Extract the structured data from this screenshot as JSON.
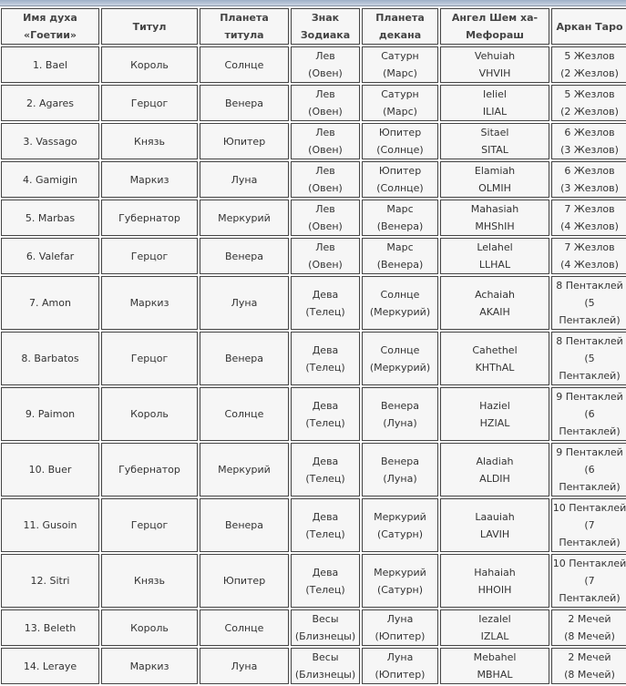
{
  "headers": [
    "Имя духа «Гоетии»",
    "Титул",
    "Планета титула",
    "Знак Зодиака",
    "Планета декана",
    "Ангел Шем ха-Мефораш",
    "Аркан Таро"
  ],
  "rows": [
    [
      "1. Bael",
      "Король",
      "Солнце",
      [
        "Лев",
        "(Овен)"
      ],
      [
        "Сатурн",
        "(Марс)"
      ],
      [
        "Vehuiah",
        "VHVIH"
      ],
      [
        "5 Жезлов",
        "(2 Жезлов)"
      ]
    ],
    [
      "2. Agares",
      "Герцог",
      "Венера",
      [
        "Лев",
        "(Овен)"
      ],
      [
        "Сатурн",
        "(Марс)"
      ],
      [
        "Ieliel",
        "ILIAL"
      ],
      [
        "5 Жезлов",
        "(2 Жезлов)"
      ]
    ],
    [
      "3. Vassago",
      "Князь",
      "Юпитер",
      [
        "Лев",
        "(Овен)"
      ],
      [
        "Юпитер",
        "(Солнце)"
      ],
      [
        "Sitael",
        "SITAL"
      ],
      [
        "6 Жезлов",
        "(3 Жезлов)"
      ]
    ],
    [
      "4. Gamigin",
      "Маркиз",
      "Луна",
      [
        "Лев",
        "(Овен)"
      ],
      [
        "Юпитер",
        "(Солнце)"
      ],
      [
        "Elamiah",
        "OLMIH"
      ],
      [
        "6 Жезлов",
        "(3 Жезлов)"
      ]
    ],
    [
      "5. Marbas",
      "Губернатор",
      "Меркурий",
      [
        "Лев",
        "(Овен)"
      ],
      [
        "Марс",
        "(Венера)"
      ],
      [
        "Mahasiah",
        "MHShIH"
      ],
      [
        "7 Жезлов",
        "(4 Жезлов)"
      ]
    ],
    [
      "6. Valefar",
      "Герцог",
      "Венера",
      [
        "Лев",
        "(Овен)"
      ],
      [
        "Марс",
        "(Венера)"
      ],
      [
        "Lelahel",
        "LLHAL"
      ],
      [
        "7 Жезлов",
        "(4 Жезлов)"
      ]
    ],
    [
      "7. Amon",
      "Маркиз",
      "Луна",
      [
        "Дева",
        "(Телец)"
      ],
      [
        "Солнце",
        "(Меркурий)"
      ],
      [
        "Achaiah",
        "AKAIH"
      ],
      [
        "8 Пентаклей",
        "(5 Пентаклей)"
      ]
    ],
    [
      "8. Barbatos",
      "Герцог",
      "Венера",
      [
        "Дева",
        "(Телец)"
      ],
      [
        "Солнце",
        "(Меркурий)"
      ],
      [
        "Cahethel",
        "KHThAL"
      ],
      [
        "8 Пентаклей",
        "(5 Пентаклей)"
      ]
    ],
    [
      "9. Paimon",
      "Король",
      "Солнце",
      [
        "Дева",
        "(Телец)"
      ],
      [
        "Венера",
        "(Луна)"
      ],
      [
        "Haziel",
        "HZIAL"
      ],
      [
        "9 Пентаклей",
        "(6 Пентаклей)"
      ]
    ],
    [
      "10. Buer",
      "Губернатор",
      "Меркурий",
      [
        "Дева",
        "(Телец)"
      ],
      [
        "Венера",
        "(Луна)"
      ],
      [
        "Aladiah",
        "ALDIH"
      ],
      [
        "9 Пентаклей",
        "(6 Пентаклей)"
      ]
    ],
    [
      "11. Gusoin",
      "Герцог",
      "Венера",
      [
        "Дева",
        "(Телец)"
      ],
      [
        "Меркурий",
        "(Сатурн)"
      ],
      [
        "Laauiah",
        "LAVIH"
      ],
      [
        "10 Пентаклей",
        "(7 Пентаклей)"
      ]
    ],
    [
      "12. Sitri",
      "Князь",
      "Юпитер",
      [
        "Дева",
        "(Телец)"
      ],
      [
        "Меркурий",
        "(Сатурн)"
      ],
      [
        "Hahaiah",
        "HHOIH"
      ],
      [
        "10 Пентаклей",
        "(7 Пентаклей)"
      ]
    ],
    [
      "13. Beleth",
      "Король",
      "Солнце",
      [
        "Весы",
        "(Близнецы)"
      ],
      [
        "Луна",
        "(Юпитер)"
      ],
      [
        "Iezalel",
        "IZLAL"
      ],
      [
        "2 Мечей",
        "(8 Мечей)"
      ]
    ],
    [
      "14. Leraye",
      "Маркиз",
      "Луна",
      [
        "Весы",
        "(Близнецы)"
      ],
      [
        "Луна",
        "(Юпитер)"
      ],
      [
        "Mebahel",
        "MBHAL"
      ],
      [
        "2 Мечей",
        "(8 Мечей)"
      ]
    ]
  ]
}
